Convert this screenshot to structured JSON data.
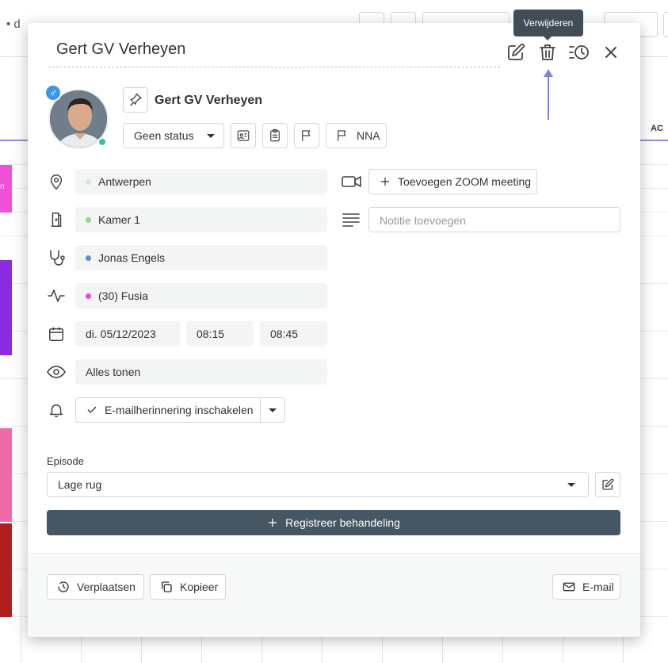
{
  "background": {
    "date_header": "• d",
    "column_label": "AC",
    "event_label": "n"
  },
  "tooltip": {
    "label": "Verwijderen"
  },
  "header": {
    "title": "Gert GV Verheyen"
  },
  "patient": {
    "name": "Gert GV Verheyen",
    "gender_symbol": "♂",
    "status_label": "Geen status",
    "flag_label": "NNA"
  },
  "fields": {
    "location": {
      "value": "Antwerpen",
      "color": "#cfe8cf"
    },
    "room": {
      "value": "Kamer 1",
      "color": "#9bcf9b"
    },
    "practitioner": {
      "value": "Jonas Engels",
      "color": "#5b8fd8"
    },
    "treatment": {
      "value": "(30) Fusia",
      "color": "#e44fcf"
    },
    "date": "di. 05/12/2023",
    "start_time": "08:15",
    "end_time": "08:45",
    "visibility": "Alles tonen",
    "reminder_label": "E-mailherinnering inschakelen"
  },
  "zoom": {
    "label": "Toevoegen ZOOM meeting"
  },
  "note": {
    "placeholder": "Notitie toevoegen"
  },
  "episode": {
    "label": "Episode",
    "value": "Lage rug"
  },
  "register": {
    "label": "Registreer behandeling"
  },
  "footer": {
    "move_label": "Verplaatsen",
    "copy_label": "Kopieer",
    "email_label": "E-mail"
  },
  "colors": {
    "primary_dark": "#465763",
    "tooltip": "#414c56",
    "pointer_arrow": "#8080e0",
    "online": "#2ec4a0",
    "gender_badge": "#3b97e3"
  }
}
